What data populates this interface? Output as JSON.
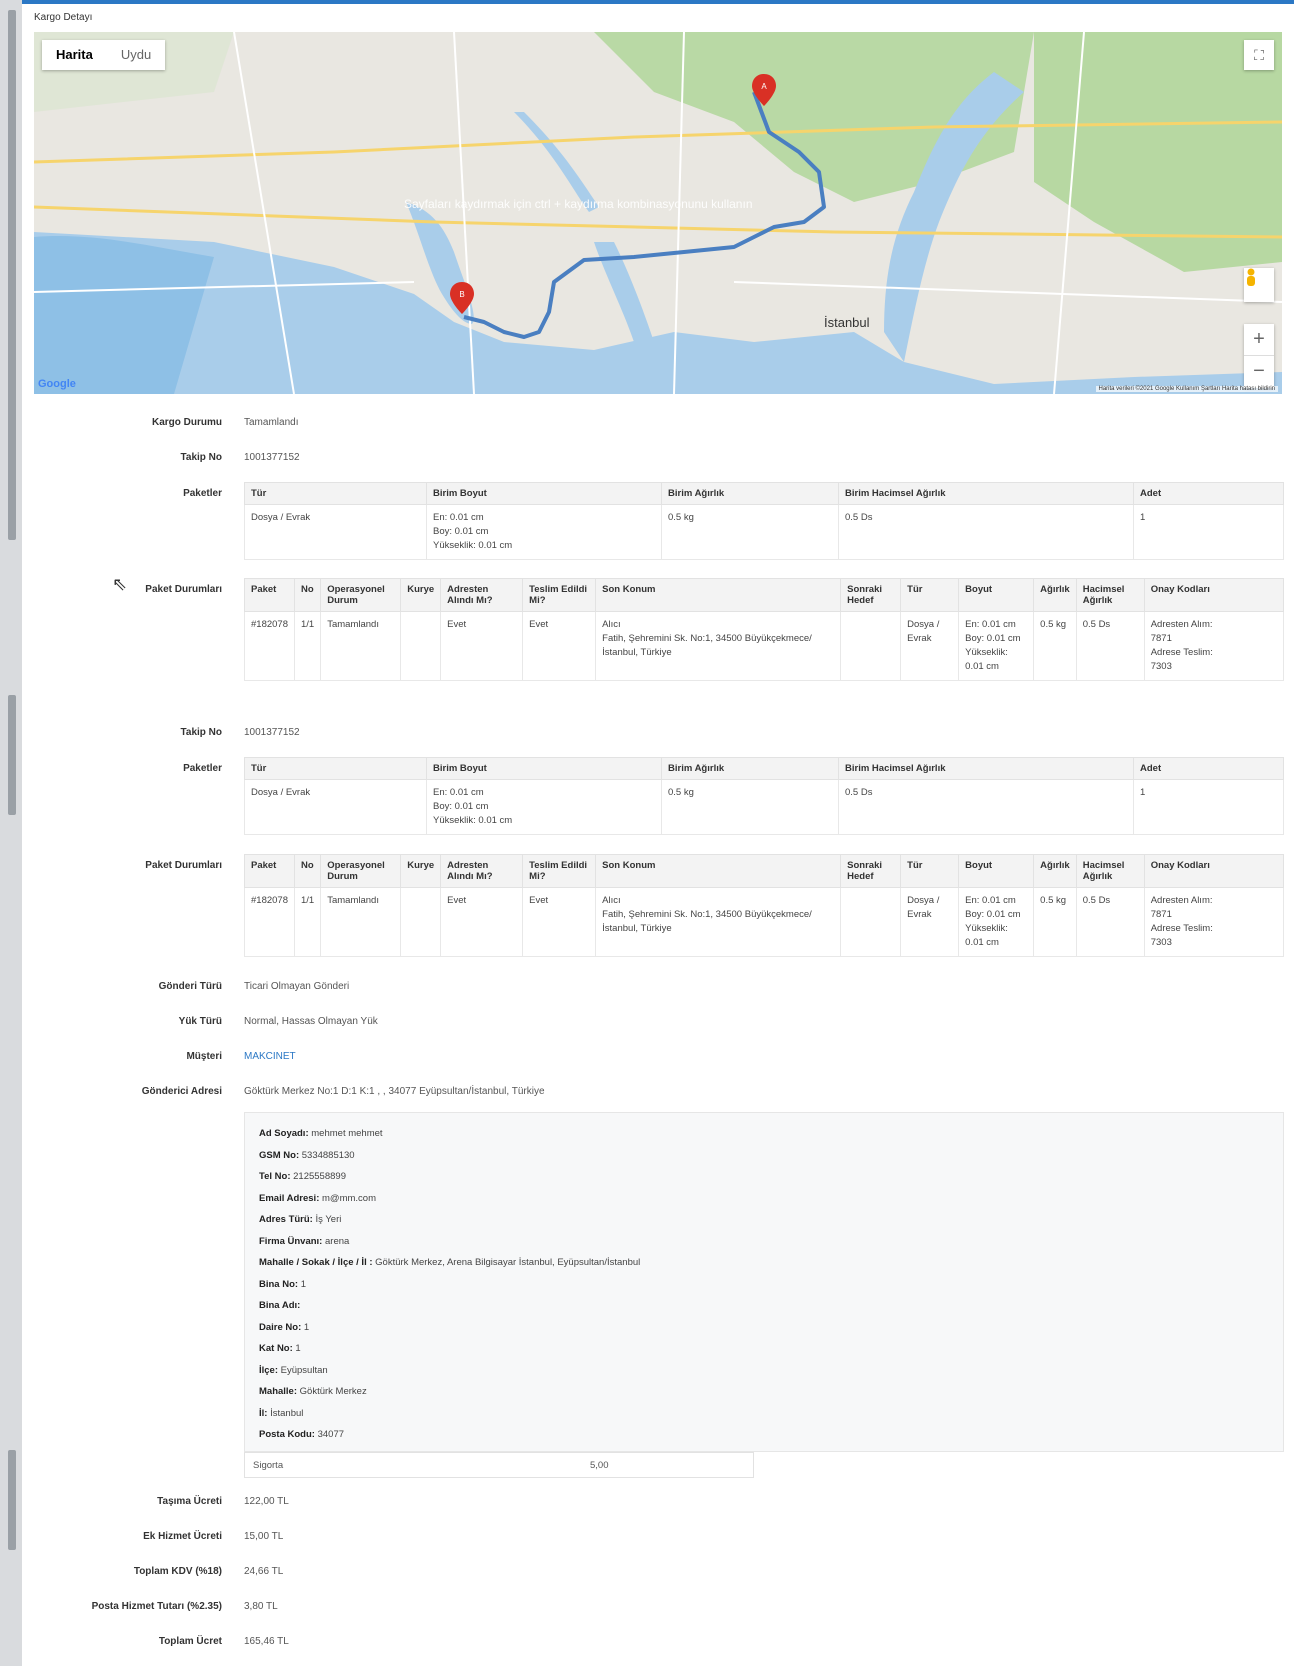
{
  "panel_title": "Kargo Detayı",
  "map": {
    "type_tabs": [
      "Harita",
      "Uydu"
    ],
    "overlay_text": "Sayfaları kaydırmak için ctrl + kaydırma kombinasyonunu kullanın",
    "city_label": "İstanbul",
    "attribution": "Harita verileri ©2021 Google  Kullanım Şartları  Harita hatası bildirin",
    "logo": "Google",
    "markers": [
      "A",
      "B"
    ],
    "zoom_in": "+",
    "zoom_out": "−"
  },
  "kargo_durumu": {
    "label": "Kargo Durumu",
    "value": "Tamamlandı"
  },
  "shipments": [
    {
      "takip_label": "Takip No",
      "takip_no": "1001377152",
      "paketler_label": "Paketler",
      "paket_headers": [
        "Tür",
        "Birim Boyut",
        "Birim Ağırlık",
        "Birim Hacimsel Ağırlık",
        "Adet"
      ],
      "paket_rows": [
        [
          "Dosya / Evrak",
          "En: 0.01 cm\nBoy: 0.01 cm\nYükseklik: 0.01 cm",
          "0.5 kg",
          "0.5 Ds",
          "1"
        ]
      ],
      "durum_label": "Paket Durumları",
      "durum_headers": [
        "Paket",
        "No",
        "Operasyonel Durum",
        "Kurye",
        "Adresten Alındı Mı?",
        "Teslim Edildi Mi?",
        "Son Konum",
        "Sonraki Hedef",
        "Tür",
        "Boyut",
        "Ağırlık",
        "Hacimsel Ağırlık",
        "Onay Kodları"
      ],
      "durum_rows": [
        [
          "#182078",
          "1/1",
          "Tamamlandı",
          "",
          "Evet",
          "Evet",
          "Alıcı\nFatih, Şehremini Sk. No:1, 34500 Büyükçekmece/\nİstanbul, Türkiye",
          "",
          "Dosya /\nEvrak",
          "En: 0.01 cm\nBoy: 0.01 cm\nYükseklik:\n0.01 cm",
          "0.5 kg",
          "0.5 Ds",
          "Adresten Alım:\n7871\nAdrese Teslim:\n7303"
        ]
      ]
    },
    {
      "takip_label": "Takip No",
      "takip_no": "1001377152",
      "paketler_label": "Paketler",
      "paket_headers": [
        "Tür",
        "Birim Boyut",
        "Birim Ağırlık",
        "Birim Hacimsel Ağırlık",
        "Adet"
      ],
      "paket_rows": [
        [
          "Dosya / Evrak",
          "En: 0.01 cm\nBoy: 0.01 cm\nYükseklik: 0.01 cm",
          "0.5 kg",
          "0.5 Ds",
          "1"
        ]
      ],
      "durum_label": "Paket Durumları",
      "durum_headers": [
        "Paket",
        "No",
        "Operasyonel Durum",
        "Kurye",
        "Adresten Alındı Mı?",
        "Teslim Edildi Mi?",
        "Son Konum",
        "Sonraki Hedef",
        "Tür",
        "Boyut",
        "Ağırlık",
        "Hacimsel Ağırlık",
        "Onay Kodları"
      ],
      "durum_rows": [
        [
          "#182078",
          "1/1",
          "Tamamlandı",
          "",
          "Evet",
          "Evet",
          "Alıcı\nFatih, Şehremini Sk. No:1, 34500 Büyükçekmece/\nİstanbul, Türkiye",
          "",
          "Dosya /\nEvrak",
          "En: 0.01 cm\nBoy: 0.01 cm\nYükseklik:\n0.01 cm",
          "0.5 kg",
          "0.5 Ds",
          "Adresten Alım:\n7871\nAdrese Teslim:\n7303"
        ]
      ]
    }
  ],
  "gonderi_turu": {
    "label": "Gönderi Türü",
    "value": "Ticari Olmayan Gönderi"
  },
  "yuk_turu": {
    "label": "Yük Türü",
    "value": "Normal, Hassas Olmayan Yük"
  },
  "musteri": {
    "label": "Müşteri",
    "value": "MAKCINET"
  },
  "gonderici_adresi": {
    "label": "Gönderici Adresi",
    "value": "Göktürk Merkez No:1 D:1 K:1 , , 34077 Eyüpsultan/İstanbul, Türkiye"
  },
  "address_details": [
    {
      "k": "Ad Soyadı:",
      "v": " mehmet mehmet"
    },
    {
      "k": "GSM No:",
      "v": " 5334885130"
    },
    {
      "k": "Tel No:",
      "v": " 2125558899"
    },
    {
      "k": "Email Adresi:",
      "v": " m@mm.com"
    },
    {
      "k": "Adres Türü:",
      "v": " İş Yeri"
    },
    {
      "k": "Firma Ünvanı:",
      "v": " arena"
    },
    {
      "k": "Mahalle / Sokak / İlçe / İl :",
      "v": " Göktürk Merkez, Arena Bilgisayar İstanbul, Eyüpsultan/İstanbul"
    },
    {
      "k": "Bina No:",
      "v": " 1"
    },
    {
      "k": "Bina Adı:",
      "v": ""
    },
    {
      "k": "Daire No:",
      "v": " 1"
    },
    {
      "k": "Kat No:",
      "v": " 1"
    },
    {
      "k": "İlçe:",
      "v": " Eyüpsultan"
    },
    {
      "k": "Mahalle:",
      "v": " Göktürk Merkez"
    },
    {
      "k": "İl:",
      "v": " İstanbul"
    },
    {
      "k": "Posta Kodu:",
      "v": " 34077"
    }
  ],
  "sigorta": {
    "label": "Sigorta",
    "value": "5,00"
  },
  "fees": [
    {
      "label": "Taşıma Ücreti",
      "value": "122,00 TL"
    },
    {
      "label": "Ek Hizmet Ücreti",
      "value": "15,00 TL"
    },
    {
      "label": "Toplam KDV (%18)",
      "value": "24,66 TL"
    },
    {
      "label": "Posta Hizmet Tutarı (%2.35)",
      "value": "3,80 TL"
    },
    {
      "label": "Toplam Ücret",
      "value": "165,46 TL"
    }
  ],
  "colors": {
    "accent": "#2b78c5",
    "route": "#4a7fc1",
    "marker": "#d93025"
  }
}
